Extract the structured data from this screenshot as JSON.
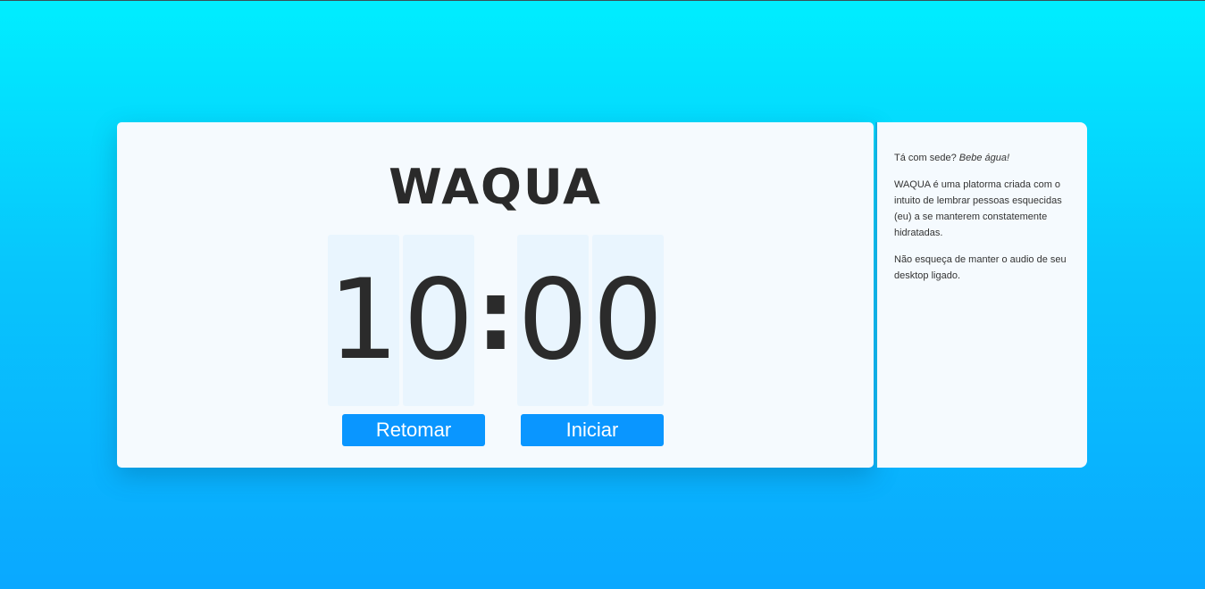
{
  "brand": {
    "logo_text": "WAQUA"
  },
  "timer": {
    "minutes_tens": "1",
    "minutes_ones": "0",
    "separator": ":",
    "seconds_tens": "0",
    "seconds_ones": "0"
  },
  "buttons": {
    "resume_label": "Retomar",
    "start_label": "Iniciar"
  },
  "info": {
    "question": "Tá com sede? ",
    "question_emphasis": "Bebe água!",
    "description": "WAQUA é uma platorma criada com o intuito de lembrar pessoas esquecidas (eu) a se manterem constatemente hidratadas.",
    "reminder": "Não esqueça de manter o audio de seu desktop ligado."
  },
  "colors": {
    "background_top": "#00eeff",
    "background_bottom": "#0aa8ff",
    "button": "#0a96ff",
    "card": "#f5fafe",
    "digit_panel": "#e9f5fe"
  }
}
